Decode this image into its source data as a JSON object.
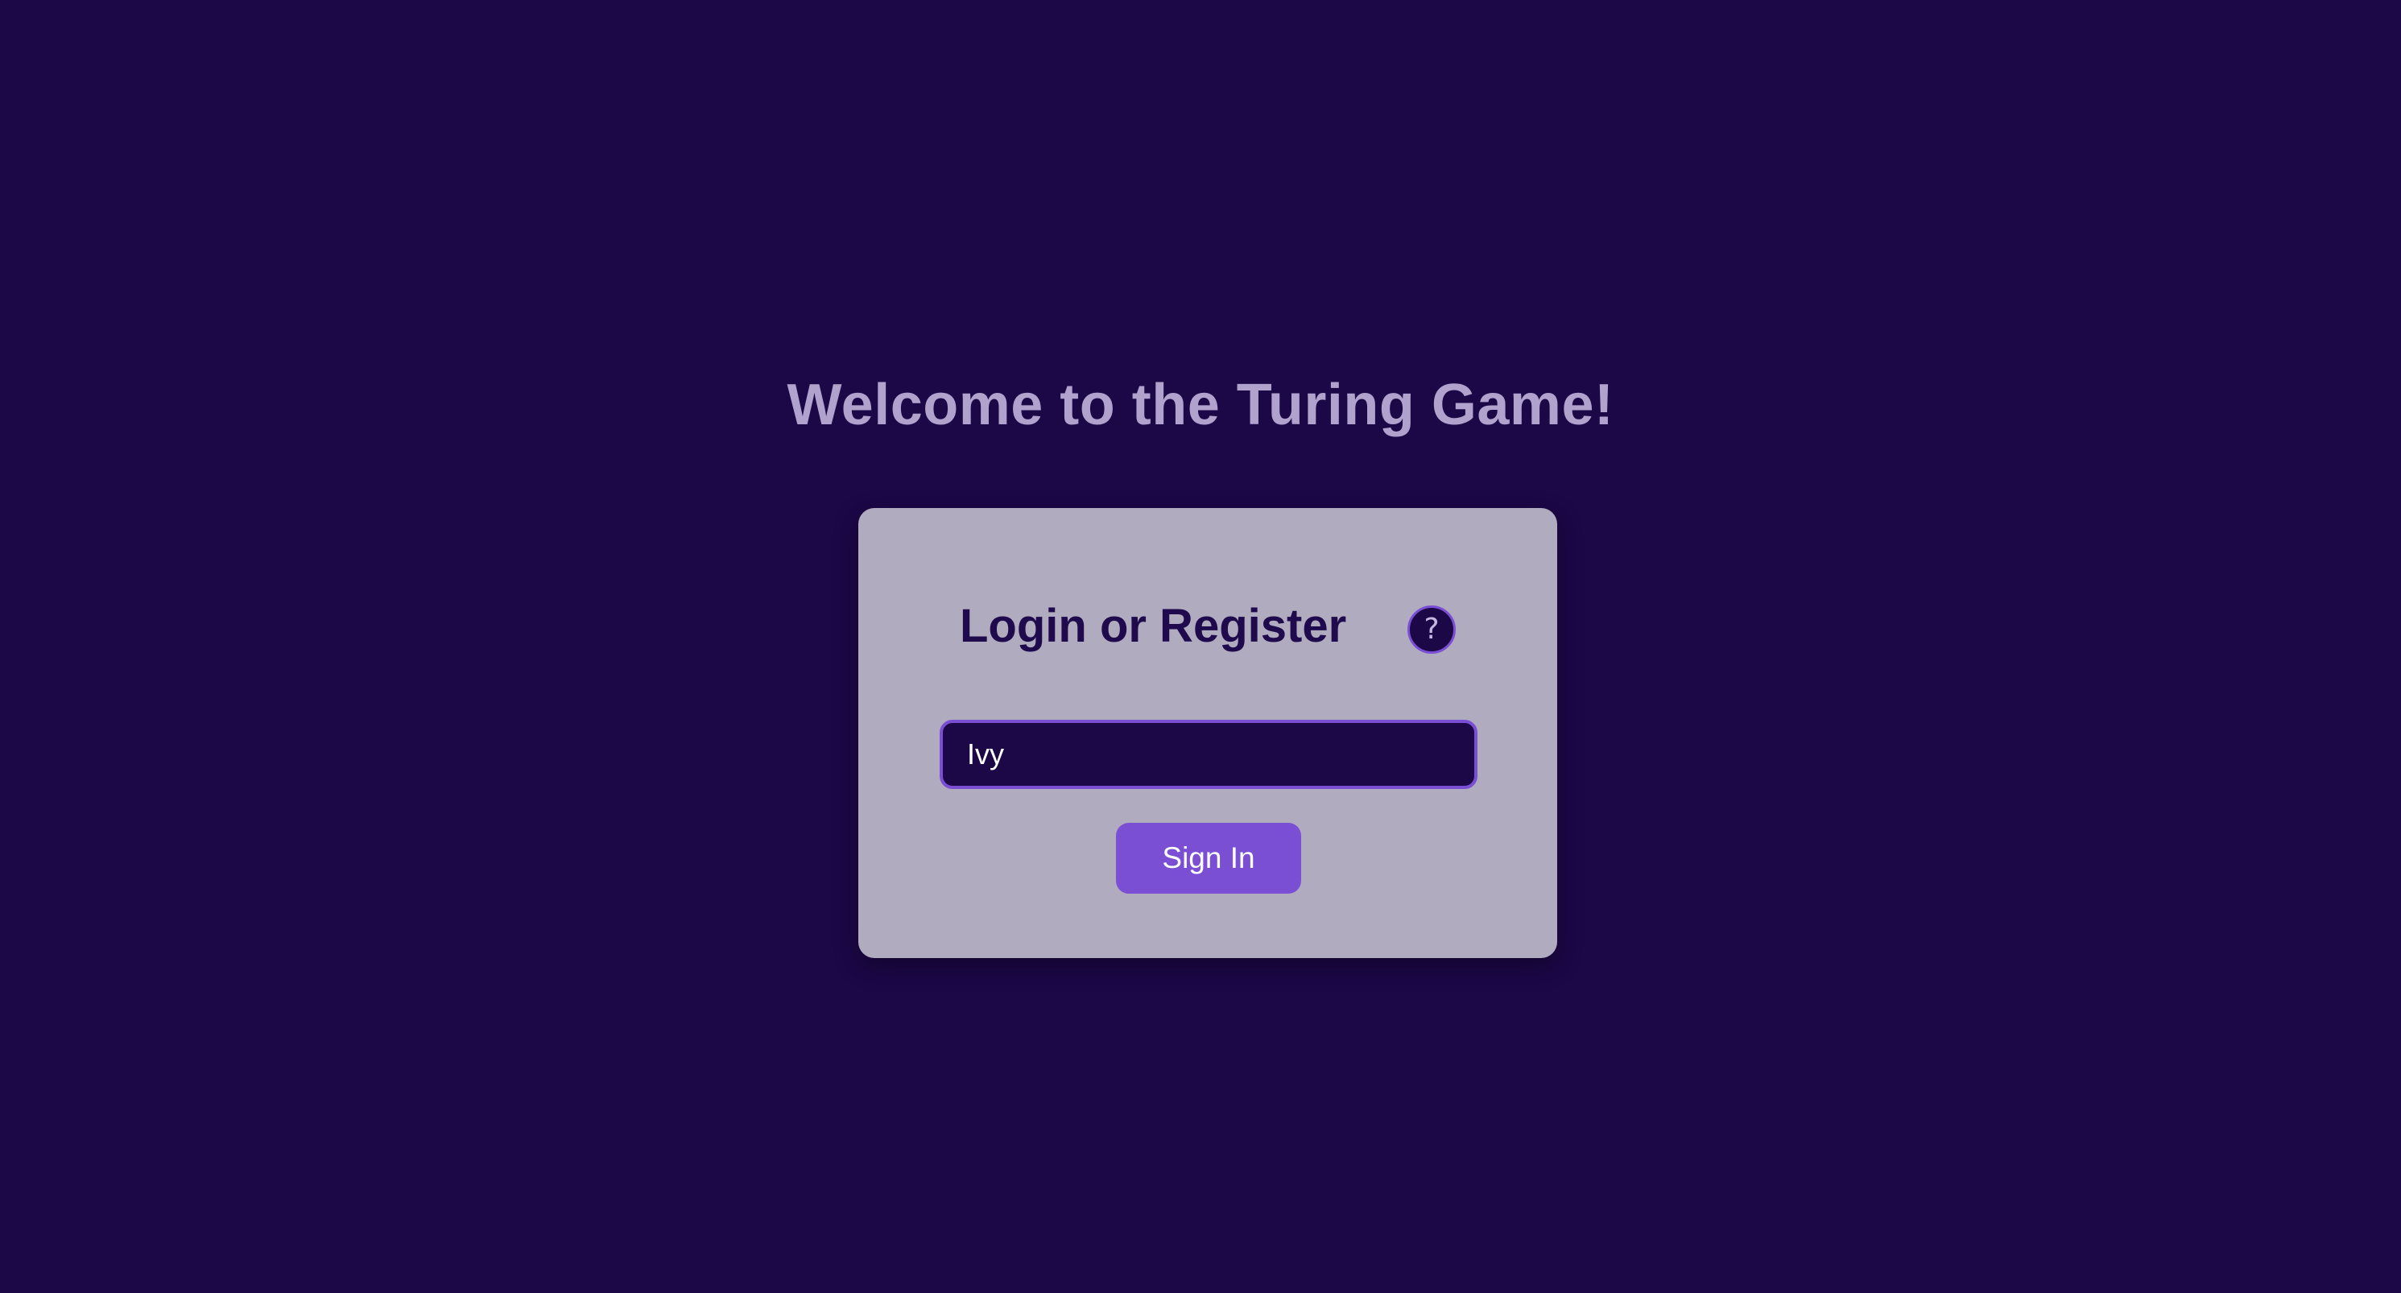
{
  "page": {
    "title": "Welcome to the Turing Game!"
  },
  "login_card": {
    "heading": "Login or Register",
    "help_label": "?",
    "help_icon": "question-mark-icon",
    "username_value": "Ivy",
    "signin_label": "Sign In"
  },
  "colors": {
    "background": "#1c0747",
    "card": "#b1abbf",
    "accent": "#7b4fd4",
    "title_text": "#b0a2cd",
    "heading_text": "#1e0a4c"
  }
}
